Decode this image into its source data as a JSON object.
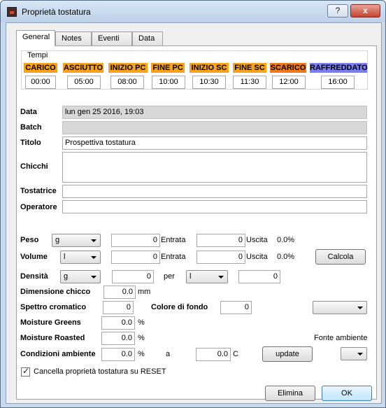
{
  "window": {
    "title": "Proprietà tostatura",
    "help_label": "?",
    "close_label": "x"
  },
  "tabs": [
    "General",
    "Notes",
    "Eventi",
    "Data"
  ],
  "tempi": {
    "title": "Tempi",
    "phases": [
      {
        "label": "CARICO",
        "time": "00:00",
        "color": "#f7a21a"
      },
      {
        "label": "ASCIUTTO",
        "time": "05:00",
        "color": "#f7a21a"
      },
      {
        "label": "INIZIO PC",
        "time": "08:00",
        "color": "#f7a21a"
      },
      {
        "label": "FINE PC",
        "time": "10:00",
        "color": "#f7a21a"
      },
      {
        "label": "INIZIO SC",
        "time": "10:30",
        "color": "#f7a21a"
      },
      {
        "label": "FINE SC",
        "time": "11:30",
        "color": "#f7a21a"
      },
      {
        "label": "SCARICO",
        "time": "12:00",
        "color": "#f07a1a"
      },
      {
        "label": "RAFFREDDATO",
        "time": "16:00",
        "color": "#7a7ef0"
      }
    ]
  },
  "info": {
    "data_label": "Data",
    "data_value": "lun gen 25 2016, 19:03",
    "batch_label": "Batch",
    "batch_value": "",
    "titolo_label": "Titolo",
    "titolo_value": "Prospettiva tostatura",
    "chicchi_label": "Chicchi",
    "chicchi_value": "",
    "tostatrice_label": "Tostatrice",
    "tostatrice_value": "",
    "operatore_label": "Operatore",
    "operatore_value": ""
  },
  "peso": {
    "label": "Peso",
    "unit": "g",
    "entrata_value": "0",
    "entrata_label": "Entrata",
    "uscita_value": "0",
    "uscita_label": "Uscita",
    "percent": "0.0%"
  },
  "volume": {
    "label": "Volume",
    "unit": "l",
    "entrata_value": "0",
    "entrata_label": "Entrata",
    "uscita_value": "0",
    "uscita_label": "Uscita",
    "percent": "0.0%",
    "calcola_label": "Calcola"
  },
  "densita": {
    "label": "Densità",
    "unit_mass": "g",
    "value": "0",
    "per_label": "per",
    "unit_vol": "l",
    "per_value": "0"
  },
  "dimensione": {
    "label": "Dimensione chicco",
    "value": "0.0",
    "unit": "mm"
  },
  "spettro": {
    "label": "Spettro cromatico",
    "value": "0",
    "fondo_label": "Colore di fondo",
    "fondo_value": "0",
    "combo_value": ""
  },
  "moisture_greens": {
    "label": "Moisture Greens",
    "value": "0.0",
    "unit": "%"
  },
  "moisture_roasted": {
    "label": "Moisture Roasted",
    "value": "0.0",
    "unit": "%",
    "fonte_label": "Fonte ambiente"
  },
  "condizioni": {
    "label": "Condizioni ambiente",
    "value": "0.0",
    "unit": "%",
    "a_label": "a",
    "temp_value": "0.0",
    "temp_unit": "C",
    "update_label": "update",
    "fonte_value": ""
  },
  "reset": {
    "label": "Cancella proprietà tostatura su RESET",
    "checked": true
  },
  "buttons": {
    "elimina": "Elimina",
    "ok": "OK"
  }
}
